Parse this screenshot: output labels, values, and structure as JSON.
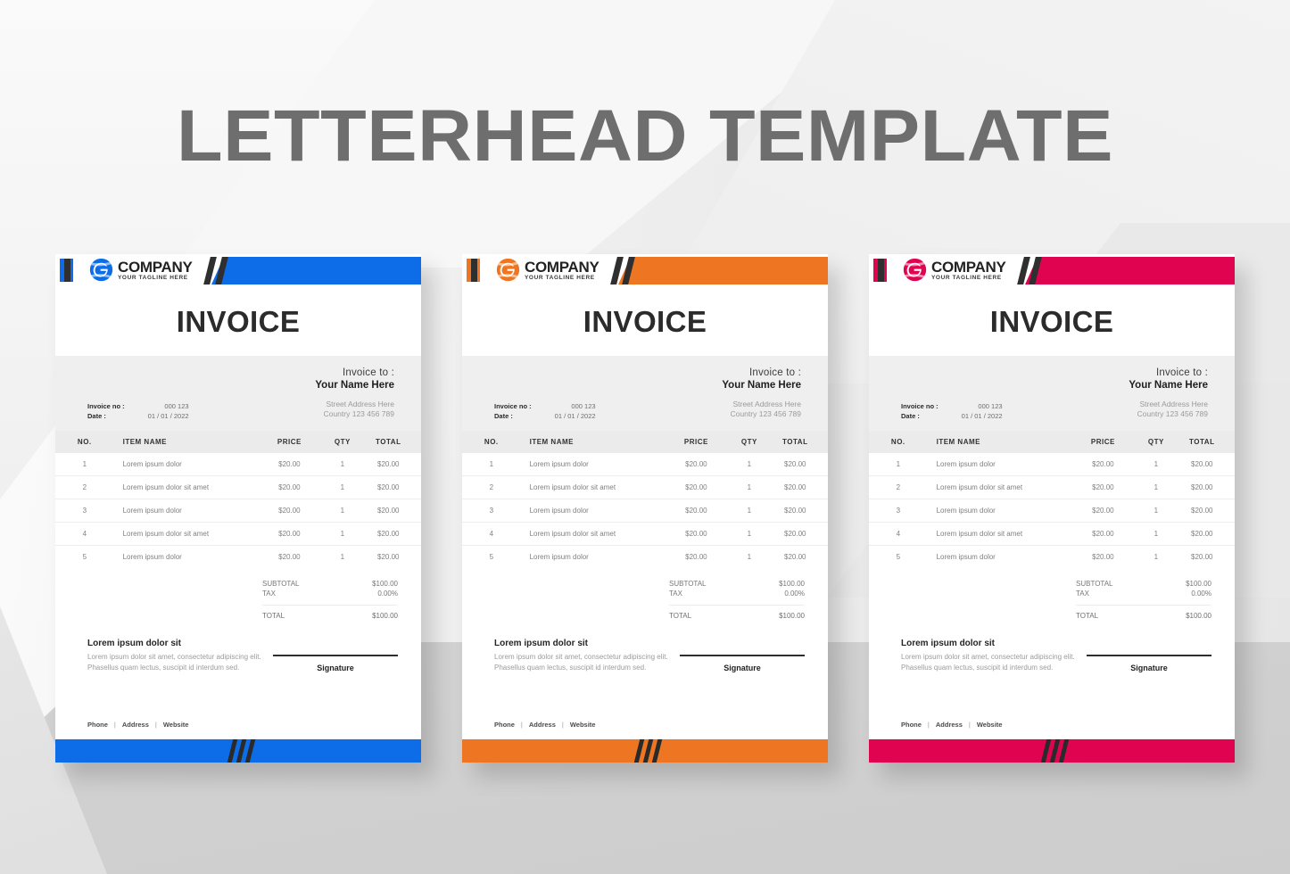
{
  "page": {
    "title": "LETTERHEAD TEMPLATE",
    "background_color": "#ececec",
    "title_color": "#6e6e6e"
  },
  "shared": {
    "logo": {
      "mark_name": "company-globe-logo",
      "name": "COMPANY",
      "tagline": "YOUR TAGLINE HERE"
    },
    "invoice_heading": "INVOICE",
    "meta": {
      "invoice_to_label": "Invoice to :",
      "client_name": "Your Name Here",
      "address_line1": "Street Address Here",
      "address_line2": "Country 123 456 789",
      "invoice_no_label": "Invoice no :",
      "date_label": "Date :",
      "invoice_no_value": "000 123",
      "date_value": "01 / 01 / 2022"
    },
    "table": {
      "headers": [
        "NO.",
        "ITEM NAME",
        "PRICE",
        "QTY",
        "TOTAL"
      ],
      "rows": [
        {
          "no": "1",
          "item": "Lorem ipsum dolor",
          "price": "$20.00",
          "qty": "1",
          "total": "$20.00"
        },
        {
          "no": "2",
          "item": "Lorem ipsum dolor sit amet",
          "price": "$20.00",
          "qty": "1",
          "total": "$20.00"
        },
        {
          "no": "3",
          "item": "Lorem ipsum dolor",
          "price": "$20.00",
          "qty": "1",
          "total": "$20.00"
        },
        {
          "no": "4",
          "item": "Lorem ipsum dolor sit amet",
          "price": "$20.00",
          "qty": "1",
          "total": "$20.00"
        },
        {
          "no": "5",
          "item": "Lorem ipsum dolor",
          "price": "$20.00",
          "qty": "1",
          "total": "$20.00"
        }
      ]
    },
    "totals": {
      "subtotal_label": "SUBTOTAL",
      "subtotal_value": "$100.00",
      "tax_label": "TAX",
      "tax_value": "0.00%",
      "total_label": "TOTAL",
      "total_value": "$100.00"
    },
    "notes": {
      "title": "Lorem ipsum dolor sit",
      "body": "Lorem ipsum dolor sit amet, consectetur adipiscing elit. Phasellus quam lectus, suscipit id interdum sed."
    },
    "signature_label": "Signature",
    "contact": {
      "phone": "Phone",
      "address": "Address",
      "website": "Website",
      "divider": "|"
    }
  },
  "cards": [
    {
      "variant": "blue",
      "accent": "#0d6ce8",
      "dark": "#2f2f2f"
    },
    {
      "variant": "orange",
      "accent": "#ee7623",
      "dark": "#2f2f2f"
    },
    {
      "variant": "crimson",
      "accent": "#e00450",
      "dark": "#2f2f2f"
    }
  ]
}
